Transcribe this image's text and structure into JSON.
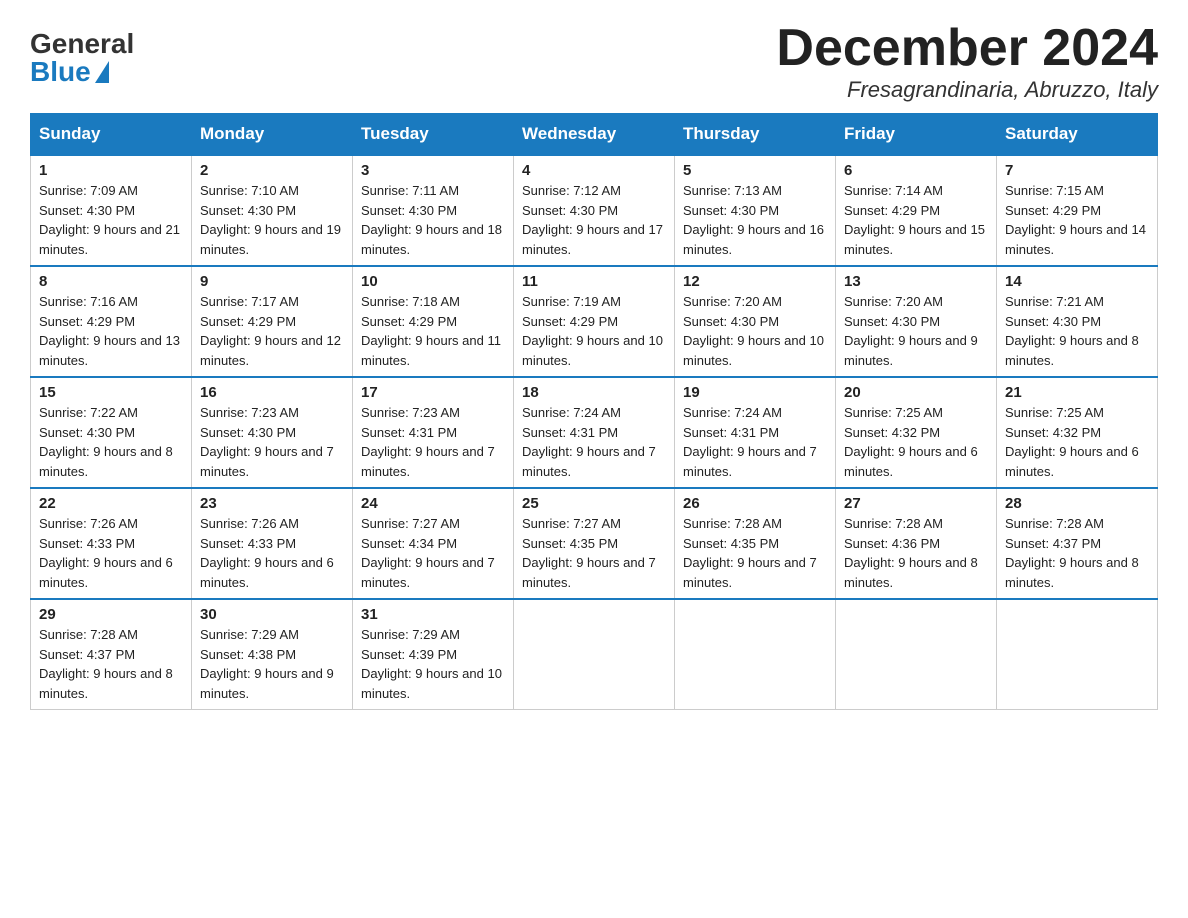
{
  "header": {
    "logo_general": "General",
    "logo_blue": "Blue",
    "title": "December 2024",
    "location": "Fresagrandinaria, Abruzzo, Italy"
  },
  "weekdays": [
    "Sunday",
    "Monday",
    "Tuesday",
    "Wednesday",
    "Thursday",
    "Friday",
    "Saturday"
  ],
  "weeks": [
    [
      {
        "day": "1",
        "sunrise": "7:09 AM",
        "sunset": "4:30 PM",
        "daylight": "9 hours and 21 minutes."
      },
      {
        "day": "2",
        "sunrise": "7:10 AM",
        "sunset": "4:30 PM",
        "daylight": "9 hours and 19 minutes."
      },
      {
        "day": "3",
        "sunrise": "7:11 AM",
        "sunset": "4:30 PM",
        "daylight": "9 hours and 18 minutes."
      },
      {
        "day": "4",
        "sunrise": "7:12 AM",
        "sunset": "4:30 PM",
        "daylight": "9 hours and 17 minutes."
      },
      {
        "day": "5",
        "sunrise": "7:13 AM",
        "sunset": "4:30 PM",
        "daylight": "9 hours and 16 minutes."
      },
      {
        "day": "6",
        "sunrise": "7:14 AM",
        "sunset": "4:29 PM",
        "daylight": "9 hours and 15 minutes."
      },
      {
        "day": "7",
        "sunrise": "7:15 AM",
        "sunset": "4:29 PM",
        "daylight": "9 hours and 14 minutes."
      }
    ],
    [
      {
        "day": "8",
        "sunrise": "7:16 AM",
        "sunset": "4:29 PM",
        "daylight": "9 hours and 13 minutes."
      },
      {
        "day": "9",
        "sunrise": "7:17 AM",
        "sunset": "4:29 PM",
        "daylight": "9 hours and 12 minutes."
      },
      {
        "day": "10",
        "sunrise": "7:18 AM",
        "sunset": "4:29 PM",
        "daylight": "9 hours and 11 minutes."
      },
      {
        "day": "11",
        "sunrise": "7:19 AM",
        "sunset": "4:29 PM",
        "daylight": "9 hours and 10 minutes."
      },
      {
        "day": "12",
        "sunrise": "7:20 AM",
        "sunset": "4:30 PM",
        "daylight": "9 hours and 10 minutes."
      },
      {
        "day": "13",
        "sunrise": "7:20 AM",
        "sunset": "4:30 PM",
        "daylight": "9 hours and 9 minutes."
      },
      {
        "day": "14",
        "sunrise": "7:21 AM",
        "sunset": "4:30 PM",
        "daylight": "9 hours and 8 minutes."
      }
    ],
    [
      {
        "day": "15",
        "sunrise": "7:22 AM",
        "sunset": "4:30 PM",
        "daylight": "9 hours and 8 minutes."
      },
      {
        "day": "16",
        "sunrise": "7:23 AM",
        "sunset": "4:30 PM",
        "daylight": "9 hours and 7 minutes."
      },
      {
        "day": "17",
        "sunrise": "7:23 AM",
        "sunset": "4:31 PM",
        "daylight": "9 hours and 7 minutes."
      },
      {
        "day": "18",
        "sunrise": "7:24 AM",
        "sunset": "4:31 PM",
        "daylight": "9 hours and 7 minutes."
      },
      {
        "day": "19",
        "sunrise": "7:24 AM",
        "sunset": "4:31 PM",
        "daylight": "9 hours and 7 minutes."
      },
      {
        "day": "20",
        "sunrise": "7:25 AM",
        "sunset": "4:32 PM",
        "daylight": "9 hours and 6 minutes."
      },
      {
        "day": "21",
        "sunrise": "7:25 AM",
        "sunset": "4:32 PM",
        "daylight": "9 hours and 6 minutes."
      }
    ],
    [
      {
        "day": "22",
        "sunrise": "7:26 AM",
        "sunset": "4:33 PM",
        "daylight": "9 hours and 6 minutes."
      },
      {
        "day": "23",
        "sunrise": "7:26 AM",
        "sunset": "4:33 PM",
        "daylight": "9 hours and 6 minutes."
      },
      {
        "day": "24",
        "sunrise": "7:27 AM",
        "sunset": "4:34 PM",
        "daylight": "9 hours and 7 minutes."
      },
      {
        "day": "25",
        "sunrise": "7:27 AM",
        "sunset": "4:35 PM",
        "daylight": "9 hours and 7 minutes."
      },
      {
        "day": "26",
        "sunrise": "7:28 AM",
        "sunset": "4:35 PM",
        "daylight": "9 hours and 7 minutes."
      },
      {
        "day": "27",
        "sunrise": "7:28 AM",
        "sunset": "4:36 PM",
        "daylight": "9 hours and 8 minutes."
      },
      {
        "day": "28",
        "sunrise": "7:28 AM",
        "sunset": "4:37 PM",
        "daylight": "9 hours and 8 minutes."
      }
    ],
    [
      {
        "day": "29",
        "sunrise": "7:28 AM",
        "sunset": "4:37 PM",
        "daylight": "9 hours and 8 minutes."
      },
      {
        "day": "30",
        "sunrise": "7:29 AM",
        "sunset": "4:38 PM",
        "daylight": "9 hours and 9 minutes."
      },
      {
        "day": "31",
        "sunrise": "7:29 AM",
        "sunset": "4:39 PM",
        "daylight": "9 hours and 10 minutes."
      },
      null,
      null,
      null,
      null
    ]
  ]
}
